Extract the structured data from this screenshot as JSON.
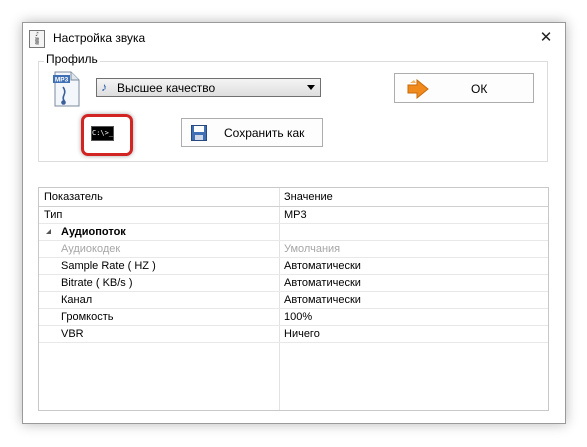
{
  "window": {
    "title": "Настройка звука",
    "close_symbol": "✕"
  },
  "profile": {
    "legend": "Профиль",
    "file_icon_label": "MP3",
    "selected_value": "Высшее качество",
    "ok_label": "ОК",
    "cmd_icon_label": "C:\\>_",
    "save_label": "Сохранить как"
  },
  "grid": {
    "columns": [
      "Показатель",
      "Значение"
    ],
    "type_row": {
      "name": "Тип",
      "value": "MP3"
    },
    "section": "Аудиопоток",
    "rows": [
      {
        "name": "Аудиокодек",
        "value": "Умолчания",
        "disabled": true
      },
      {
        "name": "Sample Rate ( HZ )",
        "value": "Автоматически"
      },
      {
        "name": "Bitrate ( KB/s )",
        "value": "Автоматически"
      },
      {
        "name": "Канал",
        "value": "Автоматически"
      },
      {
        "name": "Громкость",
        "value": "100%"
      },
      {
        "name": "VBR",
        "value": "Ничего"
      }
    ]
  },
  "colors": {
    "highlight": "#d32424",
    "ok_arrow": "#f08a1c",
    "note_icon": "#2a5db0"
  }
}
